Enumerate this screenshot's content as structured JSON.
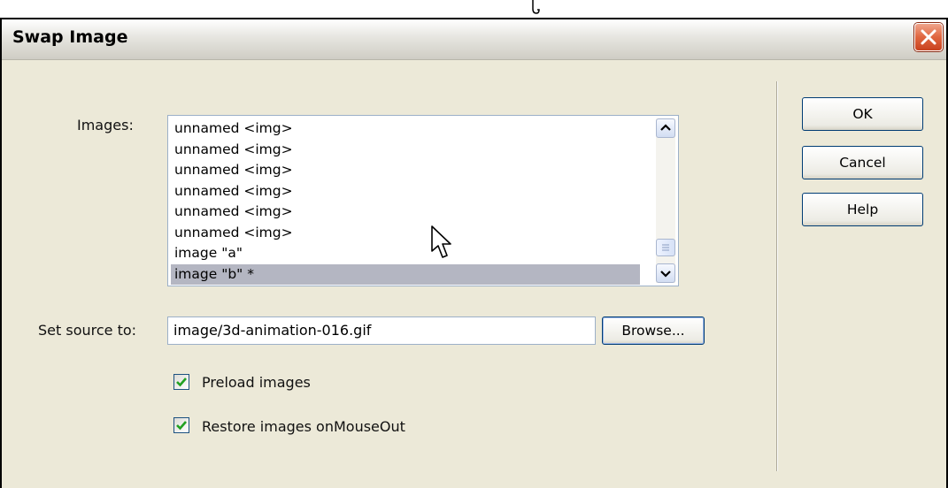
{
  "window": {
    "title": "Swap Image"
  },
  "labels": {
    "images": "Images:",
    "set_source": "Set source to:"
  },
  "images_list": {
    "items": [
      "unnamed <img>",
      "unnamed <img>",
      "unnamed <img>",
      "unnamed <img>",
      "unnamed <img>",
      "unnamed <img>",
      "image \"a\"",
      "image \"b\" *"
    ],
    "selected_index": 7
  },
  "source": {
    "value": "image/3d-animation-016.gif"
  },
  "buttons": {
    "browse": "Browse...",
    "ok": "OK",
    "cancel": "Cancel",
    "help": "Help"
  },
  "options": {
    "preload": {
      "label": "Preload images",
      "checked": true
    },
    "restore": {
      "label": "Restore images onMouseOut",
      "checked": true
    }
  },
  "colors": {
    "dialog_bg": "#ece9d8",
    "selection_bg": "#b4b6c2",
    "close_button": "#e0663f",
    "check_mark": "#21a121"
  }
}
